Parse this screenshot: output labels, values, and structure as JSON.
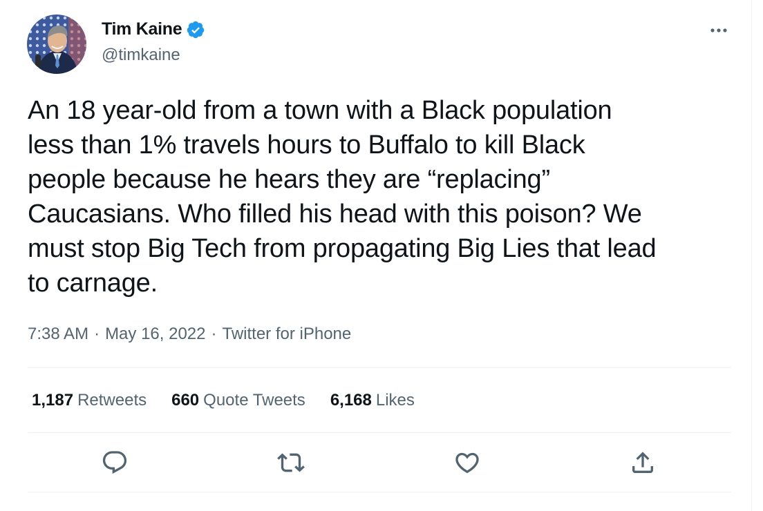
{
  "author": {
    "name": "Tim Kaine",
    "handle": "@timkaine",
    "verified": true,
    "avatar_icon": "profile-photo"
  },
  "tweet": {
    "text": "An 18 year-old from a town with a Black population\nless than 1% travels hours to Buffalo to kill Black\npeople because he hears they are “replacing”\nCaucasians. Who filled his head with this poison? We\nmust stop Big Tech from propagating Big Lies that lead\nto carnage."
  },
  "meta": {
    "time": "7:38 AM",
    "separator": "·",
    "date": "May 16, 2022",
    "source": "Twitter for iPhone"
  },
  "stats": {
    "retweets": {
      "count": "1,187",
      "label": "Retweets"
    },
    "quotes": {
      "count": "660",
      "label": "Quote Tweets"
    },
    "likes": {
      "count": "6,168",
      "label": "Likes"
    }
  },
  "actions": [
    "reply-icon",
    "retweet-icon",
    "like-icon",
    "share-icon"
  ],
  "colors": {
    "verified_blue": "#1d9bf0",
    "secondary_text": "#536471",
    "divider": "#eff3f4"
  }
}
